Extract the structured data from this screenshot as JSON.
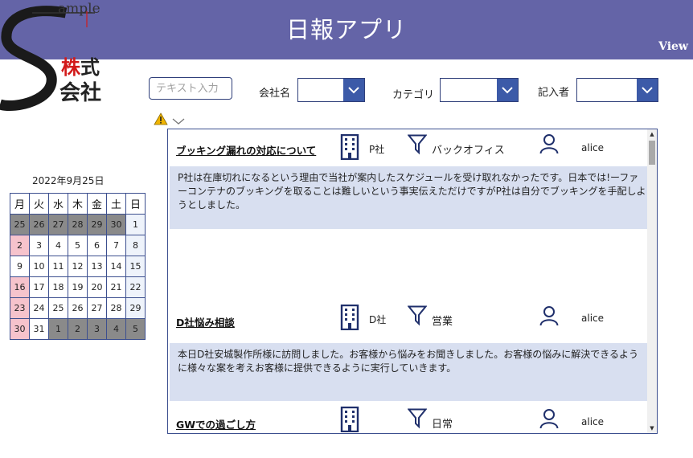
{
  "header": {
    "title": "日報アプリ",
    "view_link": "View"
  },
  "logo": {
    "sample": "ample",
    "kabu": "株",
    "shiki": "式",
    "kaisha": "会社"
  },
  "filters": {
    "search_placeholder": "テキスト入力",
    "company_label": "会社名",
    "category_label": "カテゴリ",
    "author_label": "記入者"
  },
  "calendar": {
    "title": "2022年9月25日",
    "weekdays": [
      "月",
      "火",
      "水",
      "木",
      "金",
      "土",
      "日"
    ],
    "weeks": [
      [
        "25",
        "26",
        "27",
        "28",
        "29",
        "30",
        "1"
      ],
      [
        "2",
        "3",
        "4",
        "5",
        "6",
        "7",
        "8"
      ],
      [
        "9",
        "10",
        "11",
        "12",
        "13",
        "14",
        "15"
      ],
      [
        "16",
        "17",
        "18",
        "19",
        "20",
        "21",
        "22"
      ],
      [
        "23",
        "24",
        "25",
        "26",
        "27",
        "28",
        "29"
      ],
      [
        "30",
        "31",
        "1",
        "2",
        "3",
        "4",
        "5"
      ]
    ]
  },
  "reports": [
    {
      "title": "ブッキング漏れの対応について",
      "company": "P社",
      "category": "バックオフィス",
      "author": "alice",
      "body": "P社は在庫切れになるという理由で当社が案内したスケジュールを受け取れなかったです。日本では!ーファーコンテナのブッキングを取ることは難しいという事実伝えただけですがP社は自分でブッキングを手配しようとしました。"
    },
    {
      "title": "D社悩み相談",
      "company": "D社",
      "category": "営業",
      "author": "alice",
      "body": "本日D社安城製作所様に訪問しました。お客様から悩みをお聞きしました。お客様の悩みに解決できるように様々な案を考えお客様に提供できるように実行していきます。"
    },
    {
      "title": "GWでの過ごし方",
      "company": "",
      "category": "日常",
      "author": "alice",
      "body": ""
    }
  ],
  "colors": {
    "header": "#6464a7",
    "accent": "#3c5aa8",
    "card": "#d8dff0"
  }
}
